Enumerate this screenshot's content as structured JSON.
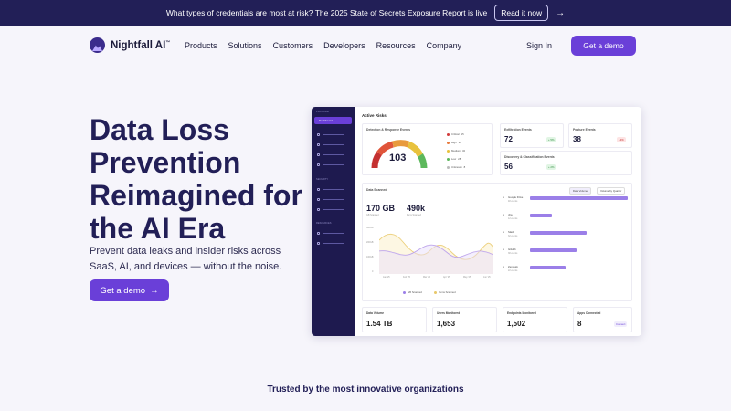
{
  "announcement": {
    "text": "What types of credentials are most at risk? The 2025 State of Secrets Exposure Report is live",
    "cta": "Read it now",
    "arrow": "→"
  },
  "nav": {
    "brand": "Nightfall AI",
    "trademark": "™",
    "menu": [
      "Products",
      "Solutions",
      "Customers",
      "Developers",
      "Resources",
      "Company"
    ],
    "sign_in": "Sign In",
    "demo": "Get a demo"
  },
  "hero": {
    "title": "Data Loss Prevention Reimagined for the AI Era",
    "subtitle": "Prevent data leaks and insider risks across SaaS, AI, and devices — without the noise.",
    "cta": "Get a demo",
    "cta_arrow": "→"
  },
  "dashboard": {
    "title": "Active Risks",
    "sidebar": {
      "section_a": "PLATFORM",
      "active": "Dashboard",
      "section_b": "SECURITY",
      "section_c": "RESOURCES"
    },
    "detection": {
      "label": "Detection & Response Events",
      "value": "103",
      "legend": [
        {
          "name": "Critical",
          "value": "15",
          "color": "#d23b3b"
        },
        {
          "name": "High",
          "value": "20",
          "color": "#e87a3d"
        },
        {
          "name": "Medium",
          "value": "32",
          "color": "#e8c23d"
        },
        {
          "name": "Low",
          "value": "28",
          "color": "#5cb85c"
        },
        {
          "name": "Unknown",
          "value": "8",
          "color": "#bbbbbb"
        }
      ]
    },
    "exfiltration": {
      "label": "Exfiltration Events",
      "value": "72",
      "delta": "+ 5%"
    },
    "posture": {
      "label": "Posture Events",
      "value": "38",
      "delta": "- 3%"
    },
    "discovery": {
      "label": "Discovery & Classification Events",
      "value": "56",
      "delta": "+ 2%"
    },
    "scanned": {
      "label": "Data Scanned",
      "tabs": [
        "Data Volume",
        "Volume by Quarter"
      ],
      "volume": "170 GB",
      "volume_label": "GB Scanned",
      "items": "490k",
      "items_label": "Items Scanned",
      "y_ticks": [
        "300GB",
        "200GB",
        "100GB",
        "0"
      ],
      "x_ticks": [
        "Jan '25",
        "Feb '25",
        "Mar '25",
        "Apr '25",
        "May '25",
        "Jun '25"
      ],
      "series": [
        "GB Scanned",
        "Items Scanned"
      ],
      "sources": [
        {
          "name": "Google Drive",
          "sub": "48 events",
          "share": 1.0
        },
        {
          "name": "Jira",
          "sub": "12 events",
          "share": 0.22
        },
        {
          "name": "Slack",
          "sub": "32 events",
          "share": 0.58
        },
        {
          "name": "GitHub",
          "sub": "38 events",
          "share": 0.48
        },
        {
          "name": "Zendesk",
          "sub": "22 events",
          "share": 0.36
        }
      ]
    },
    "stats": [
      {
        "label": "Data Volume",
        "value": "1.54 TB"
      },
      {
        "label": "Users Monitored",
        "value": "1,653"
      },
      {
        "label": "Endpoints Monitored",
        "value": "1,502"
      },
      {
        "label": "Apps Connected",
        "value": "8",
        "badge": "Connect"
      }
    ]
  },
  "trusted": "Trusted by the most innovative organizations",
  "colors": {
    "accent": "#6a3fd8",
    "navy": "#221f57",
    "bar": "#9b7fe8"
  }
}
